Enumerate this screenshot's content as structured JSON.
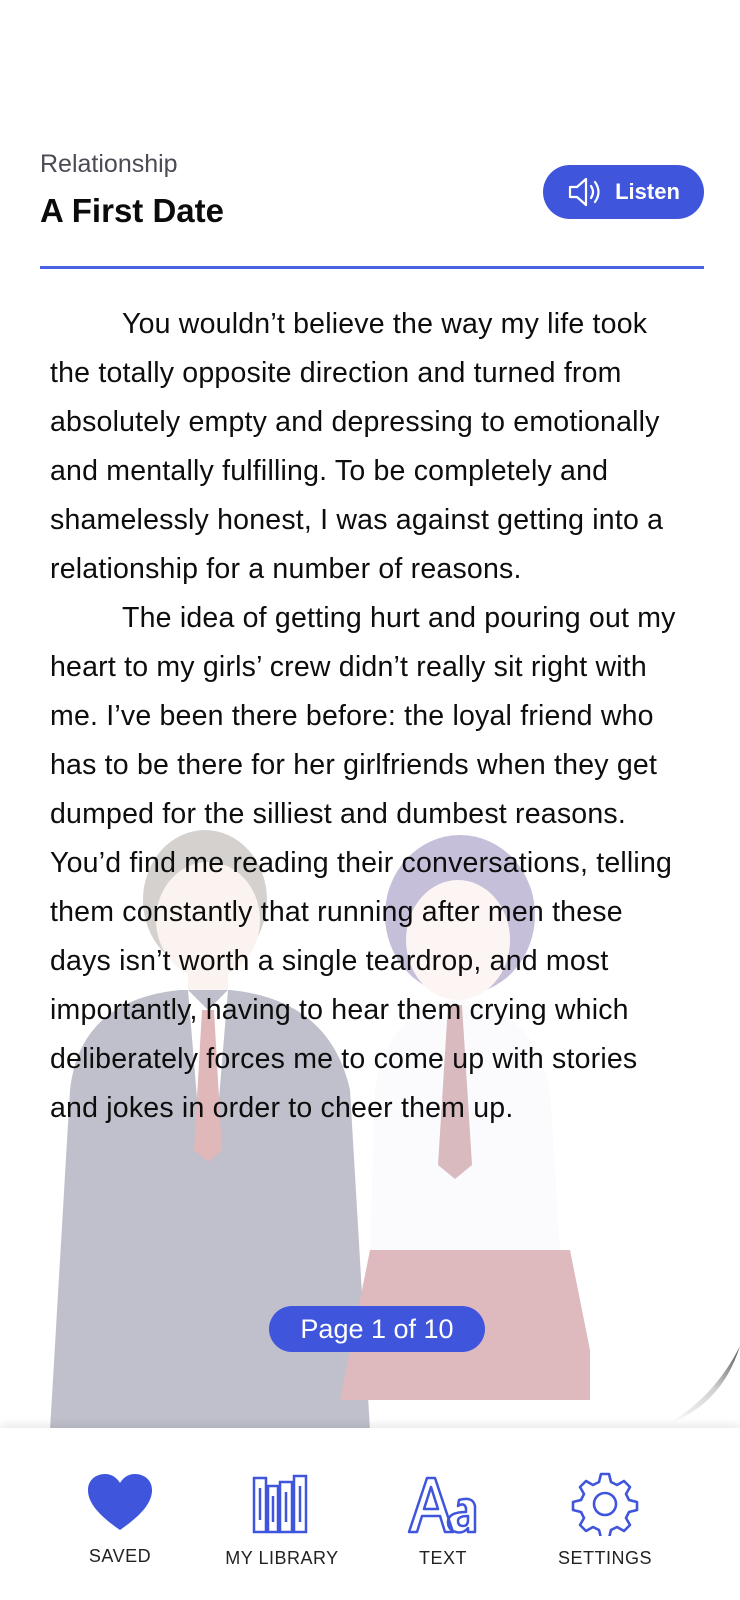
{
  "header": {
    "category": "Relationship",
    "title": "A First Date",
    "listen_label": "Listen"
  },
  "story": {
    "paragraphs": [
      "You wouldn’t believe the way my life took the totally opposite direction and turned from absolutely empty and depressing to emotionally and mentally fulfilling. To be completely and shamelessly honest, I was against getting into a relationship for a number of reasons.",
      "The idea of getting hurt and pouring out my heart to my girls’ crew didn’t really sit right with me. I’ve been there before: the loyal friend who has to be there for her girlfriends when they get dumped for the silliest and dumbest reasons. You’d find me reading their conversations, telling them constantly that running after men these days isn’t worth a single teardrop, and most importantly, having to hear them crying which deliberately forces me to come up with stories and jokes in order to cheer them up."
    ]
  },
  "pagination": {
    "label": "Page 1 of 10",
    "current": 1,
    "total": 10
  },
  "nav": {
    "saved": "SAVED",
    "library": "MY LIBRARY",
    "text": "TEXT",
    "settings": "SETTINGS"
  },
  "colors": {
    "accent": "#3f55dc",
    "divider": "#4a63e6"
  },
  "icons": [
    "speaker-icon",
    "heart-icon",
    "library-icon",
    "text-size-icon",
    "gear-icon"
  ]
}
